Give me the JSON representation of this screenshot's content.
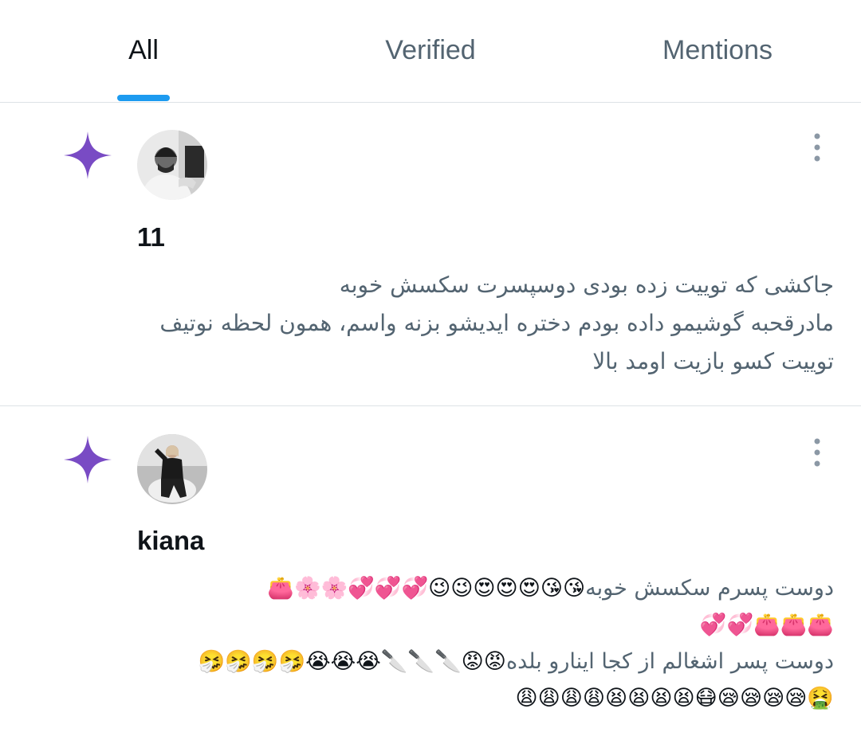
{
  "tabs": [
    {
      "label": "All",
      "active": true
    },
    {
      "label": "Verified",
      "active": false
    },
    {
      "label": "Mentions",
      "active": false
    }
  ],
  "colors": {
    "accent": "#1d9bf0",
    "star": "#794bc4",
    "text_primary": "#0f1419",
    "text_secondary": "#536471",
    "divider": "#dde2e6",
    "more_icon": "#8b98a5"
  },
  "notifications": [
    {
      "icon": "sparkle-star-icon",
      "user_name": "11",
      "lines": [
        "جاکشی که توییت زده بودی دوسپسرت سکسش خوبه",
        "مادرقحبه گوشیمو داده بودم دختره ایدیشو بزنه واسم، همون لحظه نوتیف",
        "توییت کسو بازیت اومد بالا"
      ]
    },
    {
      "icon": "sparkle-star-icon",
      "user_name": "kiana",
      "lines": [
        {
          "text": "دوست پسرم سکسش خوبه",
          "emoji": "😘😘😍😍😍😉😉💞💞💞🌸🌸👛"
        },
        {
          "text": "",
          "emoji": "👛👛👛💞💞"
        },
        {
          "text": "دوست پسر اشغالم از کجا اینارو بلده",
          "emoji": "😡😡🔪🔪🔪😭😭😭🤧🤧🤧🤧"
        },
        {
          "text": "",
          "emoji": "🤮😪😪😪😪😷😫😫😫😫😩😩😩😩"
        }
      ]
    }
  ]
}
